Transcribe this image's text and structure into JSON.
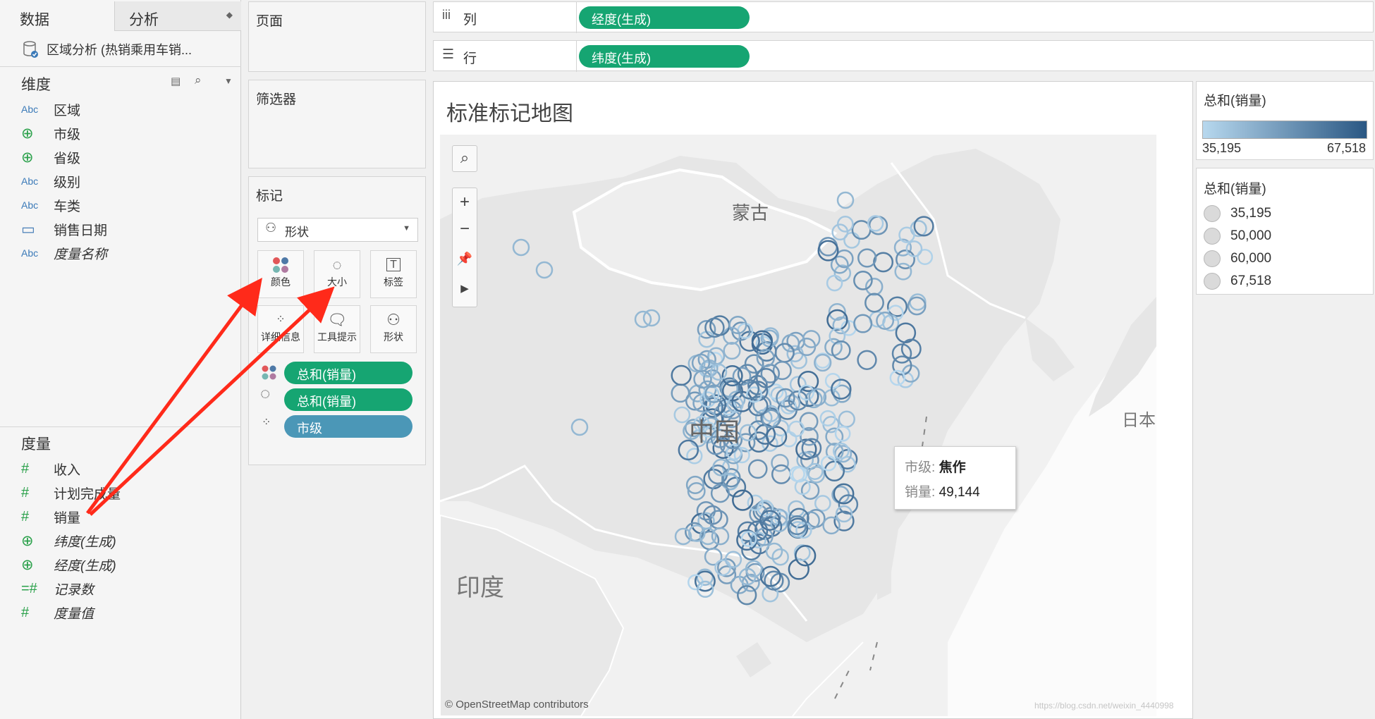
{
  "left_pane": {
    "tab_data": "数据",
    "tab_analysis": "分析",
    "datasource": "区域分析 (热销乘用车销...",
    "dimensions_title": "维度",
    "dimensions": [
      {
        "icon": "Abc",
        "label": "区域"
      },
      {
        "icon": "globe-icon",
        "label": "市级"
      },
      {
        "icon": "globe-icon",
        "label": "省级"
      },
      {
        "icon": "Abc",
        "label": "级别"
      },
      {
        "icon": "Abc",
        "label": "车类"
      },
      {
        "icon": "calendar-icon",
        "label": "销售日期"
      },
      {
        "icon": "Abc",
        "label": "度量名称"
      }
    ],
    "measures_title": "度量",
    "measures": [
      {
        "icon": "#",
        "label": "收入"
      },
      {
        "icon": "#",
        "label": "计划完成量"
      },
      {
        "icon": "#",
        "label": "销量"
      },
      {
        "icon": "globe-icon",
        "label": "纬度(生成)"
      },
      {
        "icon": "globe-icon",
        "label": "经度(生成)"
      },
      {
        "icon": "=#",
        "label": "记录数"
      },
      {
        "icon": "#",
        "label": "度量值"
      }
    ]
  },
  "cards": {
    "pages_title": "页面",
    "filters_title": "筛选器",
    "marks_title": "标记",
    "mark_type": "形状",
    "mark_buttons": [
      "颜色",
      "大小",
      "标签",
      "详细信息",
      "工具提示",
      "形状"
    ],
    "mark_pills": [
      "总和(销量)",
      "总和(销量)",
      "市级"
    ]
  },
  "shelves": {
    "columns_label": "列",
    "columns_pill": "经度(生成)",
    "rows_label": "行",
    "rows_pill": "纬度(生成)"
  },
  "view": {
    "title": "标准标记地图",
    "labels": {
      "mongolia": "蒙古",
      "china": "中国",
      "india": "印度",
      "japan": "日本"
    },
    "attribution": "© OpenStreetMap contributors",
    "watermark": "https://blog.csdn.net/weixin_4440998"
  },
  "tooltip": {
    "label1": "市级:",
    "value1": "焦作",
    "label2": "销量:",
    "value2": "49,144"
  },
  "color_legend": {
    "title": "总和(销量)",
    "min": "35,195",
    "max": "67,518",
    "color_low": "#b7d8ee",
    "color_high": "#2a5783"
  },
  "size_legend": {
    "title": "总和(销量)",
    "items": [
      "35,195",
      "50,000",
      "60,000",
      "67,518"
    ]
  }
}
